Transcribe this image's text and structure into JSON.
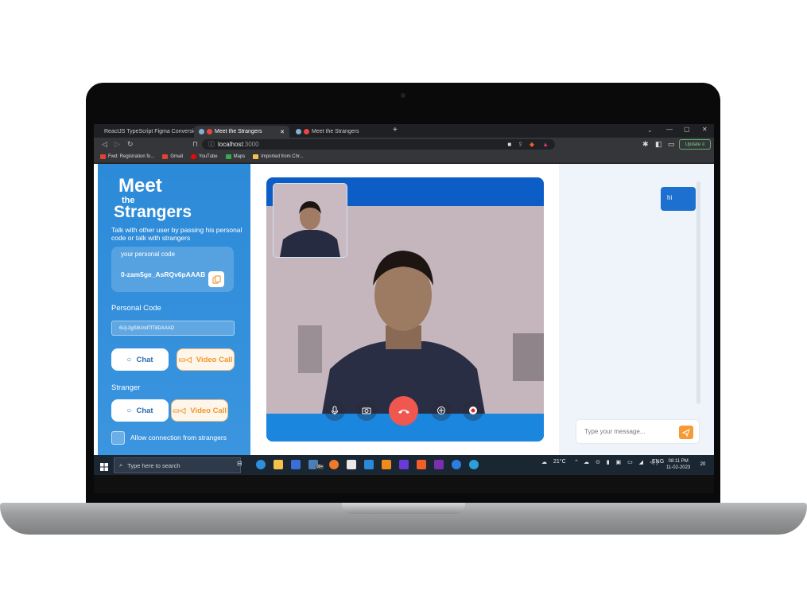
{
  "browser": {
    "tabs": [
      {
        "label": "ReactJS TypeScript Figma Conversion",
        "active": false
      },
      {
        "label": "Meet the Strangers",
        "active": true
      },
      {
        "label": "Meet the Strangers",
        "active": false
      }
    ],
    "new_tab": "+",
    "url_host": "localhost",
    "url_port": ":3000",
    "update_label": "Update",
    "bookmarks": [
      {
        "label": "Fwd: Registration fo...",
        "icon": "gmail-icon",
        "color": "#e34133"
      },
      {
        "label": "Gmail",
        "icon": "gmail-icon",
        "color": "#e34133"
      },
      {
        "label": "YouTube",
        "icon": "youtube-icon",
        "color": "#ff0000"
      },
      {
        "label": "Maps",
        "icon": "maps-icon",
        "color": "#34a853"
      },
      {
        "label": "Imported from Chr...",
        "icon": "folder-icon",
        "color": "#f2c14e"
      }
    ]
  },
  "sidebar": {
    "logo_meet": "Meet",
    "logo_the": "the",
    "logo_strangers": "Strangers",
    "description": "Talk with other user by passing his personal code or talk with strangers",
    "code_label": "your personal code",
    "code_value": "0-zam5ge_AsRQv6pAAAB",
    "personal_code_heading": "Personal Code",
    "personal_code_input": "6Uj-3gSbUndTfT8DAAAD",
    "chat_label": "Chat",
    "video_call_label": "Video Call",
    "stranger_heading": "Stranger",
    "stranger_chat_label": "Chat",
    "stranger_video_label": "Video Call",
    "allow_label": "Allow connection from strangers"
  },
  "chat": {
    "messages": [
      {
        "text": "hi",
        "from": "me"
      }
    ],
    "input_placeholder": "Type your message..."
  },
  "taskbar": {
    "search_placeholder": "Type here to search",
    "badge": "99+",
    "temperature": "21°C",
    "lang": "ENG",
    "time": "08:11 PM",
    "date": "11-02-2023",
    "notifications": "20"
  },
  "colors": {
    "sidebar": "#2c8ad8",
    "video_frame": "#0c5ec6",
    "hangup": "#f0574f",
    "accent_orange": "#f79a35",
    "bubble": "#1d70cf"
  }
}
